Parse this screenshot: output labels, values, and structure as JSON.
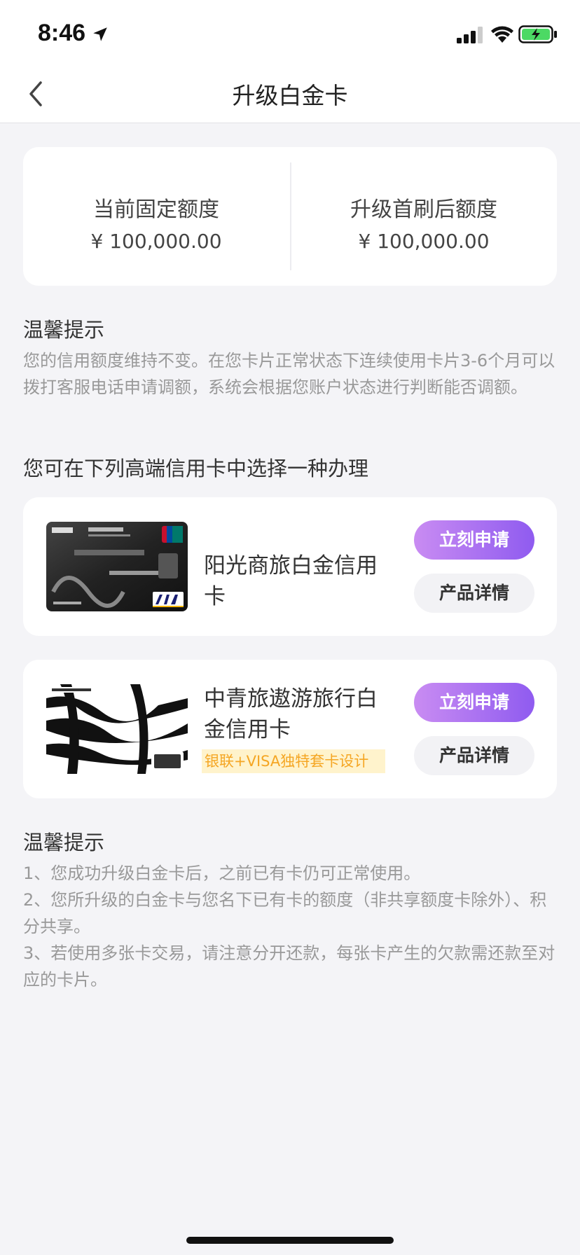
{
  "status": {
    "time": "8:46"
  },
  "nav": {
    "title": "升级白金卡"
  },
  "limits": {
    "current": {
      "label": "当前固定额度",
      "value": "¥ 100,000.00"
    },
    "upgraded": {
      "label": "升级首刷后额度",
      "value": "¥ 100,000.00"
    }
  },
  "tip1": {
    "title": "温馨提示",
    "text": "您的信用额度维持不变。在您卡片正常状态下连续使用卡片3-6个月可以拨打客服电话申请调额，系统会根据您账户状态进行判断能否调额。"
  },
  "section": {
    "title": "您可在下列高端信用卡中选择一种办理"
  },
  "cards": [
    {
      "name": "阳光商旅白金信用卡",
      "apply_label": "立刻申请",
      "detail_label": "产品详情",
      "image_icon": "platinum-card-black-icon"
    },
    {
      "name": "中青旅遨游旅行白金信用卡",
      "tag": "银联+VISA独特套卡设计",
      "apply_label": "立刻申请",
      "detail_label": "产品详情",
      "image_icon": "zebra-card-icon"
    }
  ],
  "tip2": {
    "title": "温馨提示",
    "items": [
      "1、您成功升级白金卡后，之前已有卡仍可正常使用。",
      "2、您所升级的白金卡与您名下已有卡的额度（非共享额度卡除外）、积分共享。",
      "3、若使用多张卡交易，请注意分开还款，每张卡产生的欠款需还款至对应的卡片。"
    ]
  },
  "colors": {
    "accent_gradient_start": "#c98cf2",
    "accent_gradient_end": "#8f5bf0",
    "tag_background": "#fff3cc",
    "tag_text": "#f5a623",
    "page_background": "#f4f4f7"
  }
}
